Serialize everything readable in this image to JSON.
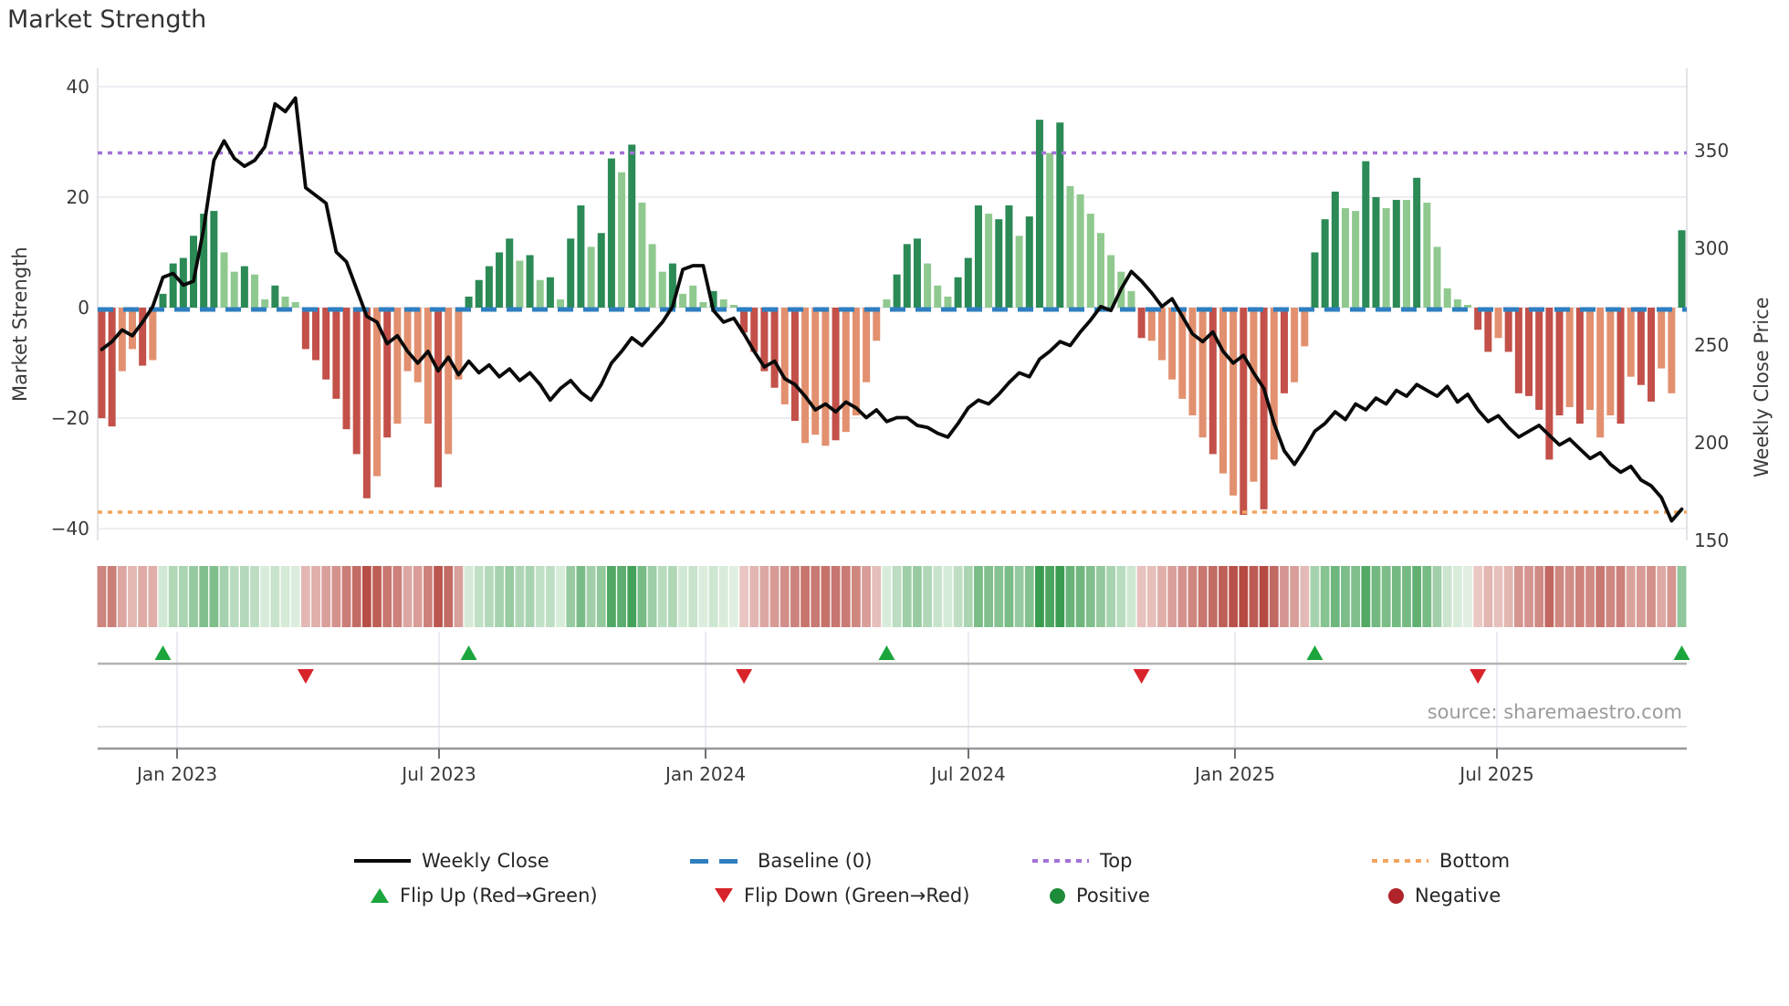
{
  "title": "Market Strength",
  "source": "source: sharemaestro.com",
  "axes": {
    "left_label": "Market Strength",
    "right_label": "Weekly Close Price",
    "left_ticks": [
      "40",
      "20",
      "0",
      "−20",
      "−40"
    ],
    "right_ticks": [
      "350",
      "300",
      "250",
      "200",
      "150"
    ],
    "x_ticks": [
      "Jan 2023",
      "Jul 2023",
      "Jan 2024",
      "Jul 2024",
      "Jan 2025",
      "Jul 2025"
    ]
  },
  "legend": {
    "items": [
      {
        "label": "Weekly Close"
      },
      {
        "label": "Baseline (0)"
      },
      {
        "label": "Top"
      },
      {
        "label": "Bottom"
      },
      {
        "label": "Flip Up (Red→Green)"
      },
      {
        "label": "Flip Down (Green→Red)"
      },
      {
        "label": "Positive"
      },
      {
        "label": "Negative"
      }
    ]
  },
  "colors": {
    "bar_dark_green": "#2b8a55",
    "bar_light_green": "#90c98f",
    "bar_dark_red": "#c35049",
    "bar_salmon": "#e2906f",
    "price_line": "#0a0a0a",
    "baseline_blue": "#2f7fc0",
    "top_purple": "#a472d8",
    "bottom_orange": "#f2a55f",
    "flip_up_green": "#1ca53c",
    "flip_down_red": "#d8232a",
    "positive_dot": "#1e8b3b",
    "negative_dot": "#b02328",
    "grid": "#e8e8ef"
  },
  "chart_data": {
    "type": "bar+line",
    "frequency": "weekly",
    "x_start": "2022-11-07",
    "x_tick_labels": [
      "Jan 2023",
      "Jul 2023",
      "Jan 2024",
      "Jul 2024",
      "Jan 2025",
      "Jul 2025"
    ],
    "left_axis": {
      "label": "Market Strength",
      "ticks": [
        40,
        20,
        0,
        -20,
        -40
      ],
      "range": [
        -43,
        43.5
      ]
    },
    "right_axis": {
      "label": "Weekly Close Price",
      "ticks": [
        350,
        300,
        250,
        200,
        150
      ],
      "range": [
        150,
        392
      ]
    },
    "baseline": 0,
    "top_level": 28,
    "bottom_level": -37,
    "strength": [
      -20,
      -21.5,
      -11.5,
      -7.5,
      -10.5,
      -9.5,
      2.5,
      8,
      9,
      13,
      17,
      17.5,
      10,
      6.5,
      7.5,
      6,
      1.5,
      4,
      2,
      1,
      -7.5,
      -9.5,
      -13,
      -16.5,
      -22,
      -26.5,
      -34.5,
      -30.5,
      -23.5,
      -21,
      -11.5,
      -13.5,
      -21,
      -32.5,
      -26.5,
      -13,
      2,
      5,
      7.5,
      10,
      12.5,
      8.5,
      9.5,
      5,
      5.5,
      1.5,
      12.5,
      18.5,
      11,
      13.5,
      27,
      24.5,
      29.5,
      19,
      11.5,
      6.5,
      8,
      2.5,
      4,
      1,
      3,
      1.5,
      0.5,
      -4.5,
      -8,
      -11.5,
      -14.5,
      -17.5,
      -20.5,
      -24.5,
      -23,
      -25,
      -24,
      -22.5,
      -19.5,
      -13.5,
      -6,
      1.5,
      6,
      11.5,
      12.5,
      8,
      4,
      2,
      5.5,
      9,
      18.5,
      17,
      16,
      18.5,
      13,
      16.5,
      34,
      28,
      33.5,
      22,
      20.5,
      17,
      13.5,
      9.5,
      6.5,
      3,
      -5.5,
      -6,
      -9.5,
      -13,
      -16.5,
      -19.5,
      -23.5,
      -26.5,
      -30,
      -34,
      -37.5,
      -31.5,
      -36.5,
      -27.5,
      -15.5,
      -13.5,
      -7,
      10,
      16,
      21,
      18,
      17.5,
      26.5,
      20,
      18,
      19.5,
      19.5,
      23.5,
      19,
      11,
      3.5,
      1.5,
      0.5,
      -4,
      -8,
      -5.5,
      -8,
      -15.5,
      -16,
      -18.5,
      -27.5,
      -19.5,
      -18,
      -21,
      -18.5,
      -23.5,
      -19.5,
      -21,
      -12.5,
      -14,
      -17,
      -11,
      -15.5,
      14
    ],
    "bar_shade": [
      "dr",
      "dr",
      "sl",
      "sl",
      "dr",
      "sl",
      "dg",
      "dg",
      "dg",
      "dg",
      "dg",
      "dg",
      "lg",
      "lg",
      "dg",
      "lg",
      "lg",
      "dg",
      "lg",
      "lg",
      "dr",
      "dr",
      "dr",
      "dr",
      "dr",
      "dr",
      "dr",
      "sl",
      "dr",
      "sl",
      "sl",
      "sl",
      "sl",
      "dr",
      "sl",
      "sl",
      "dg",
      "dg",
      "dg",
      "dg",
      "dg",
      "lg",
      "dg",
      "lg",
      "dg",
      "lg",
      "dg",
      "dg",
      "lg",
      "dg",
      "dg",
      "lg",
      "dg",
      "lg",
      "lg",
      "lg",
      "dg",
      "lg",
      "lg",
      "lg",
      "dg",
      "lg",
      "lg",
      "dr",
      "dr",
      "dr",
      "dr",
      "sl",
      "dr",
      "sl",
      "sl",
      "sl",
      "dr",
      "sl",
      "sl",
      "sl",
      "sl",
      "lg",
      "dg",
      "dg",
      "dg",
      "lg",
      "lg",
      "lg",
      "dg",
      "dg",
      "dg",
      "lg",
      "dg",
      "dg",
      "lg",
      "dg",
      "dg",
      "lg",
      "dg",
      "lg",
      "lg",
      "lg",
      "lg",
      "lg",
      "lg",
      "lg",
      "dr",
      "sl",
      "sl",
      "sl",
      "sl",
      "sl",
      "sl",
      "dr",
      "sl",
      "sl",
      "dr",
      "sl",
      "dr",
      "sl",
      "dr",
      "sl",
      "sl",
      "dg",
      "dg",
      "dg",
      "lg",
      "lg",
      "dg",
      "dg",
      "lg",
      "dg",
      "lg",
      "dg",
      "lg",
      "lg",
      "lg",
      "lg",
      "lg",
      "dr",
      "dr",
      "sl",
      "dr",
      "dr",
      "dr",
      "dr",
      "dr",
      "dr",
      "sl",
      "dr",
      "sl",
      "sl",
      "sl",
      "dr",
      "sl",
      "dr",
      "dr",
      "sl",
      "sl",
      "dg"
    ],
    "weekly_close": [
      248,
      252,
      258,
      255,
      262,
      270,
      285,
      287,
      281,
      283,
      310,
      345,
      355,
      346,
      342,
      345,
      352,
      374,
      370,
      377,
      331,
      327,
      323,
      298,
      293,
      279,
      265,
      262,
      251,
      255,
      247,
      241,
      247,
      237,
      244,
      235,
      242,
      236,
      240,
      234,
      238,
      232,
      236,
      230,
      222,
      228,
      232,
      226,
      222,
      230,
      241,
      247,
      254,
      250,
      256,
      262,
      270,
      289,
      291,
      291,
      268,
      262,
      264,
      256,
      247,
      239,
      242,
      233,
      230,
      224,
      217,
      220,
      216,
      221,
      218,
      213,
      217,
      211,
      213,
      213,
      209,
      208,
      205,
      203,
      210,
      218,
      222,
      220,
      225,
      231,
      236,
      234,
      243,
      247,
      252,
      250,
      257,
      263,
      270,
      268,
      279,
      288,
      283,
      277,
      270,
      274,
      265,
      256,
      252,
      257,
      247,
      241,
      245,
      236,
      228,
      210,
      196,
      189,
      197,
      206,
      210,
      216,
      212,
      220,
      217,
      223,
      220,
      227,
      224,
      230,
      227,
      224,
      229,
      221,
      225,
      217,
      211,
      214,
      208,
      203,
      206,
      209,
      204,
      199,
      202,
      197,
      192,
      195,
      189,
      185,
      188,
      181,
      178,
      172,
      160,
      166
    ],
    "flip_up_weeks": [
      6,
      36,
      77,
      119,
      155
    ],
    "flip_down_weeks": [
      20,
      63,
      102,
      135
    ]
  }
}
